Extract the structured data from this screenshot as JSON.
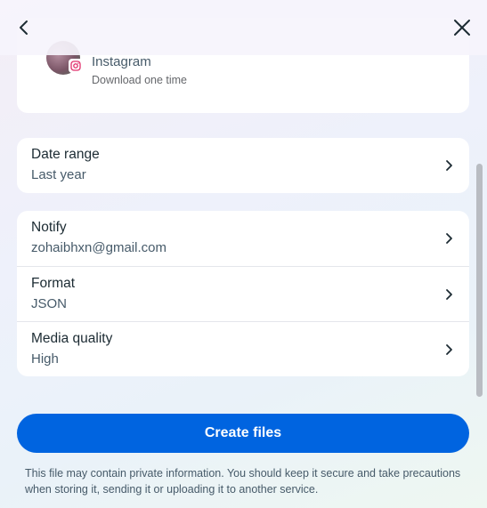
{
  "header": {
    "back_icon": "chevron-left-icon",
    "close_icon": "close-icon"
  },
  "account": {
    "name": "Instagram",
    "subtitle": "Download one time",
    "badge_icon": "instagram-icon"
  },
  "date_range": {
    "title": "Date range",
    "value": "Last year"
  },
  "settings": [
    {
      "title": "Notify",
      "value": "zohaibhxn@gmail.com"
    },
    {
      "title": "Format",
      "value": "JSON"
    },
    {
      "title": "Media quality",
      "value": "High"
    }
  ],
  "actions": {
    "create_label": "Create files"
  },
  "disclaimer": "This file may contain private information. You should keep it secure and take precautions when storing it, sending it or uploading it to another service.",
  "colors": {
    "primary": "#0064e0",
    "text": "#1c2b33",
    "secondary_text": "#465a69",
    "instagram": "#e1306c"
  }
}
